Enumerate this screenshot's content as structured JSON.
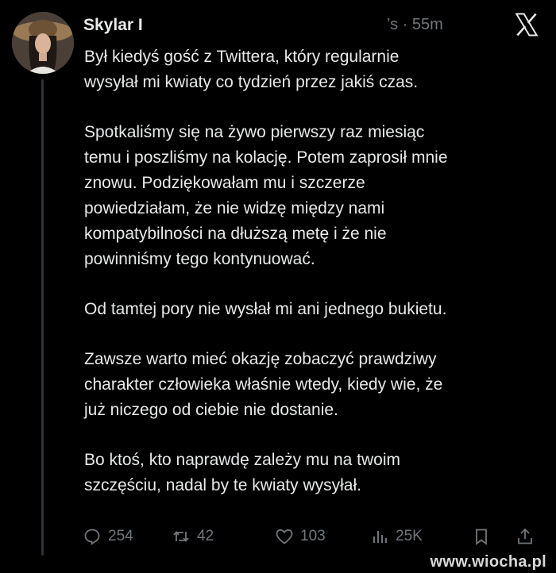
{
  "tweet": {
    "author_name": "Skylar I",
    "time_fragment": "’s · 55m",
    "paragraphs": [
      "Był kiedyś gość z Twittera, który regularnie\nwysyłał mi kwiaty co tydzień przez jakiś czas.",
      "Spotkaliśmy się na żywo pierwszy raz miesiąc\ntemu i poszliśmy na kolację. Potem zaprosił mnie\nznowu. Podziękowałam mu i szczerze\npowiedziałam, że nie widzę między nami\nkompatybilności na dłuższą metę i że nie\npowinniśmy tego kontynuować.",
      "Od tamtej pory nie wysłał mi ani jednego bukietu.",
      "Zawsze warto mieć okazję zobaczyć prawdziwy\ncharakter człowieka właśnie wtedy, kiedy wie, że\njuż niczego od ciebie nie dostanie.",
      "Bo ktoś, kto naprawdę zależy mu na twoim\nszczęściu, nadal by te kwiaty wysyłał."
    ]
  },
  "actions": {
    "replies": "254",
    "reposts": "42",
    "likes": "103",
    "views": "25K"
  },
  "icons": [
    "x-logo-icon",
    "reply-icon",
    "repost-icon",
    "like-icon",
    "views-icon",
    "bookmark-icon",
    "share-icon"
  ],
  "watermark": "www.wiocha.pl",
  "colors": {
    "background": "#000000",
    "text": "#e7e9ea",
    "muted": "#71767b"
  }
}
